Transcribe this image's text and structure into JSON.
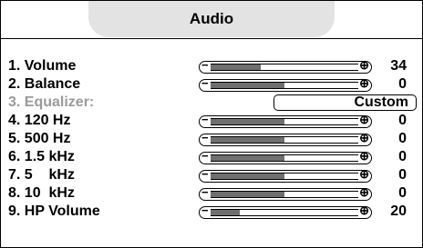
{
  "menu": {
    "title": "Audio",
    "rows": [
      {
        "label": "1. Volume",
        "value": "34",
        "level": 0.34
      },
      {
        "label": "2. Balance",
        "value": "0",
        "level": 0.5
      },
      {
        "label": "3. Equalizer:",
        "option": "Custom"
      },
      {
        "label": "4. 120 Hz",
        "value": "0",
        "level": 0.5
      },
      {
        "label": "5. 500 Hz",
        "value": "0",
        "level": 0.5
      },
      {
        "label": "6. 1.5 kHz",
        "value": "0",
        "level": 0.5
      },
      {
        "label": "7. 5    kHz",
        "value": "0",
        "level": 0.5
      },
      {
        "label": "8. 10  kHz",
        "value": "0",
        "level": 0.5
      },
      {
        "label": "9. HP Volume",
        "value": "20",
        "level": 0.2
      }
    ],
    "slider_minus": "−",
    "slider_plus": "⊕"
  },
  "colors": {
    "fill": "#6f6f6f",
    "title_bg": "#e3e3e3",
    "disabled_text": "#9a9a9a"
  }
}
